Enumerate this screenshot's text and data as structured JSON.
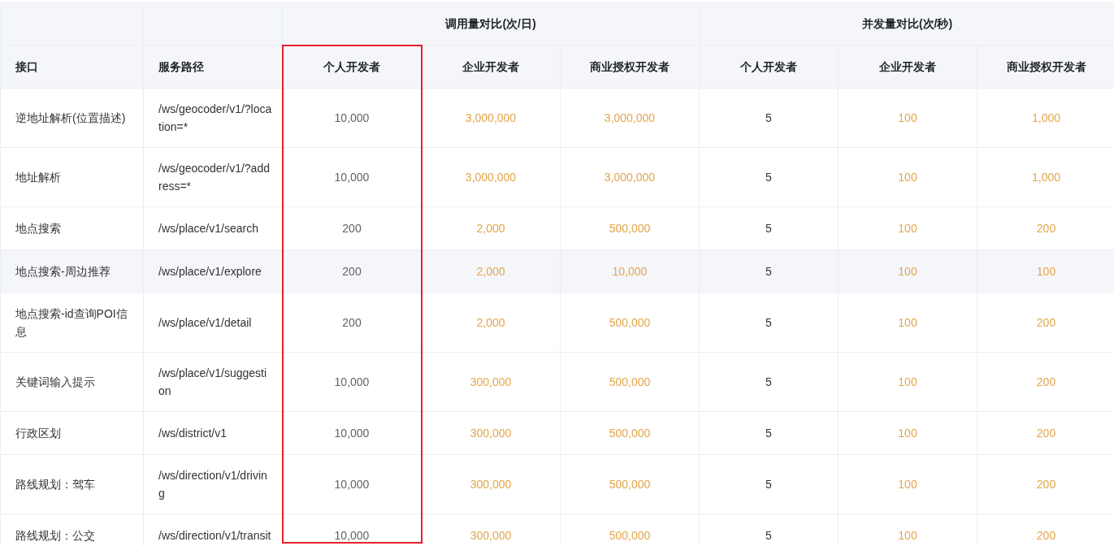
{
  "column_groups": [
    {
      "label": "调用量对比(次/日)"
    },
    {
      "label": "并发量对比(次/秒)"
    }
  ],
  "columns": [
    {
      "label": "接口",
      "kind": "text",
      "highlighted": false
    },
    {
      "label": "服务路径",
      "kind": "text",
      "highlighted": false
    },
    {
      "label": "个人开发者",
      "kind": "muted",
      "highlighted": true
    },
    {
      "label": "企业开发者",
      "kind": "accent",
      "highlighted": false
    },
    {
      "label": "商业授权开发者",
      "kind": "accent",
      "highlighted": false
    },
    {
      "label": "个人开发者",
      "kind": "text",
      "highlighted": false
    },
    {
      "label": "企业开发者",
      "kind": "accent",
      "highlighted": false
    },
    {
      "label": "商业授权开发者",
      "kind": "accent",
      "highlighted": false
    }
  ],
  "rows": [
    {
      "hovered": false,
      "cells": [
        "逆地址解析(位置描述)",
        "/ws/geocoder/v1/?location=*",
        "10,000",
        "3,000,000",
        "3,000,000",
        "5",
        "100",
        "1,000"
      ]
    },
    {
      "hovered": false,
      "cells": [
        "地址解析",
        "/ws/geocoder/v1/?address=*",
        "10,000",
        "3,000,000",
        "3,000,000",
        "5",
        "100",
        "1,000"
      ]
    },
    {
      "hovered": false,
      "cells": [
        "地点搜索",
        "/ws/place/v1/search",
        "200",
        "2,000",
        "500,000",
        "5",
        "100",
        "200"
      ]
    },
    {
      "hovered": true,
      "cells": [
        "地点搜索-周边推荐",
        "/ws/place/v1/explore",
        "200",
        "2,000",
        "10,000",
        "5",
        "100",
        "100"
      ]
    },
    {
      "hovered": false,
      "cells": [
        "地点搜索-id查询POI信息",
        "/ws/place/v1/detail",
        "200",
        "2,000",
        "500,000",
        "5",
        "100",
        "200"
      ]
    },
    {
      "hovered": false,
      "cells": [
        "关键词输入提示",
        "/ws/place/v1/suggestion",
        "10,000",
        "300,000",
        "500,000",
        "5",
        "100",
        "200"
      ]
    },
    {
      "hovered": false,
      "cells": [
        "行政区划",
        "/ws/district/v1",
        "10,000",
        "300,000",
        "500,000",
        "5",
        "100",
        "200"
      ]
    },
    {
      "hovered": false,
      "cells": [
        "路线规划：驾车",
        "/ws/direction/v1/driving",
        "10,000",
        "300,000",
        "500,000",
        "5",
        "100",
        "200"
      ]
    },
    {
      "hovered": false,
      "cells": [
        "路线规划：公交",
        "/ws/direction/v1/transit",
        "10,000",
        "300,000",
        "500,000",
        "5",
        "100",
        "200"
      ]
    }
  ]
}
